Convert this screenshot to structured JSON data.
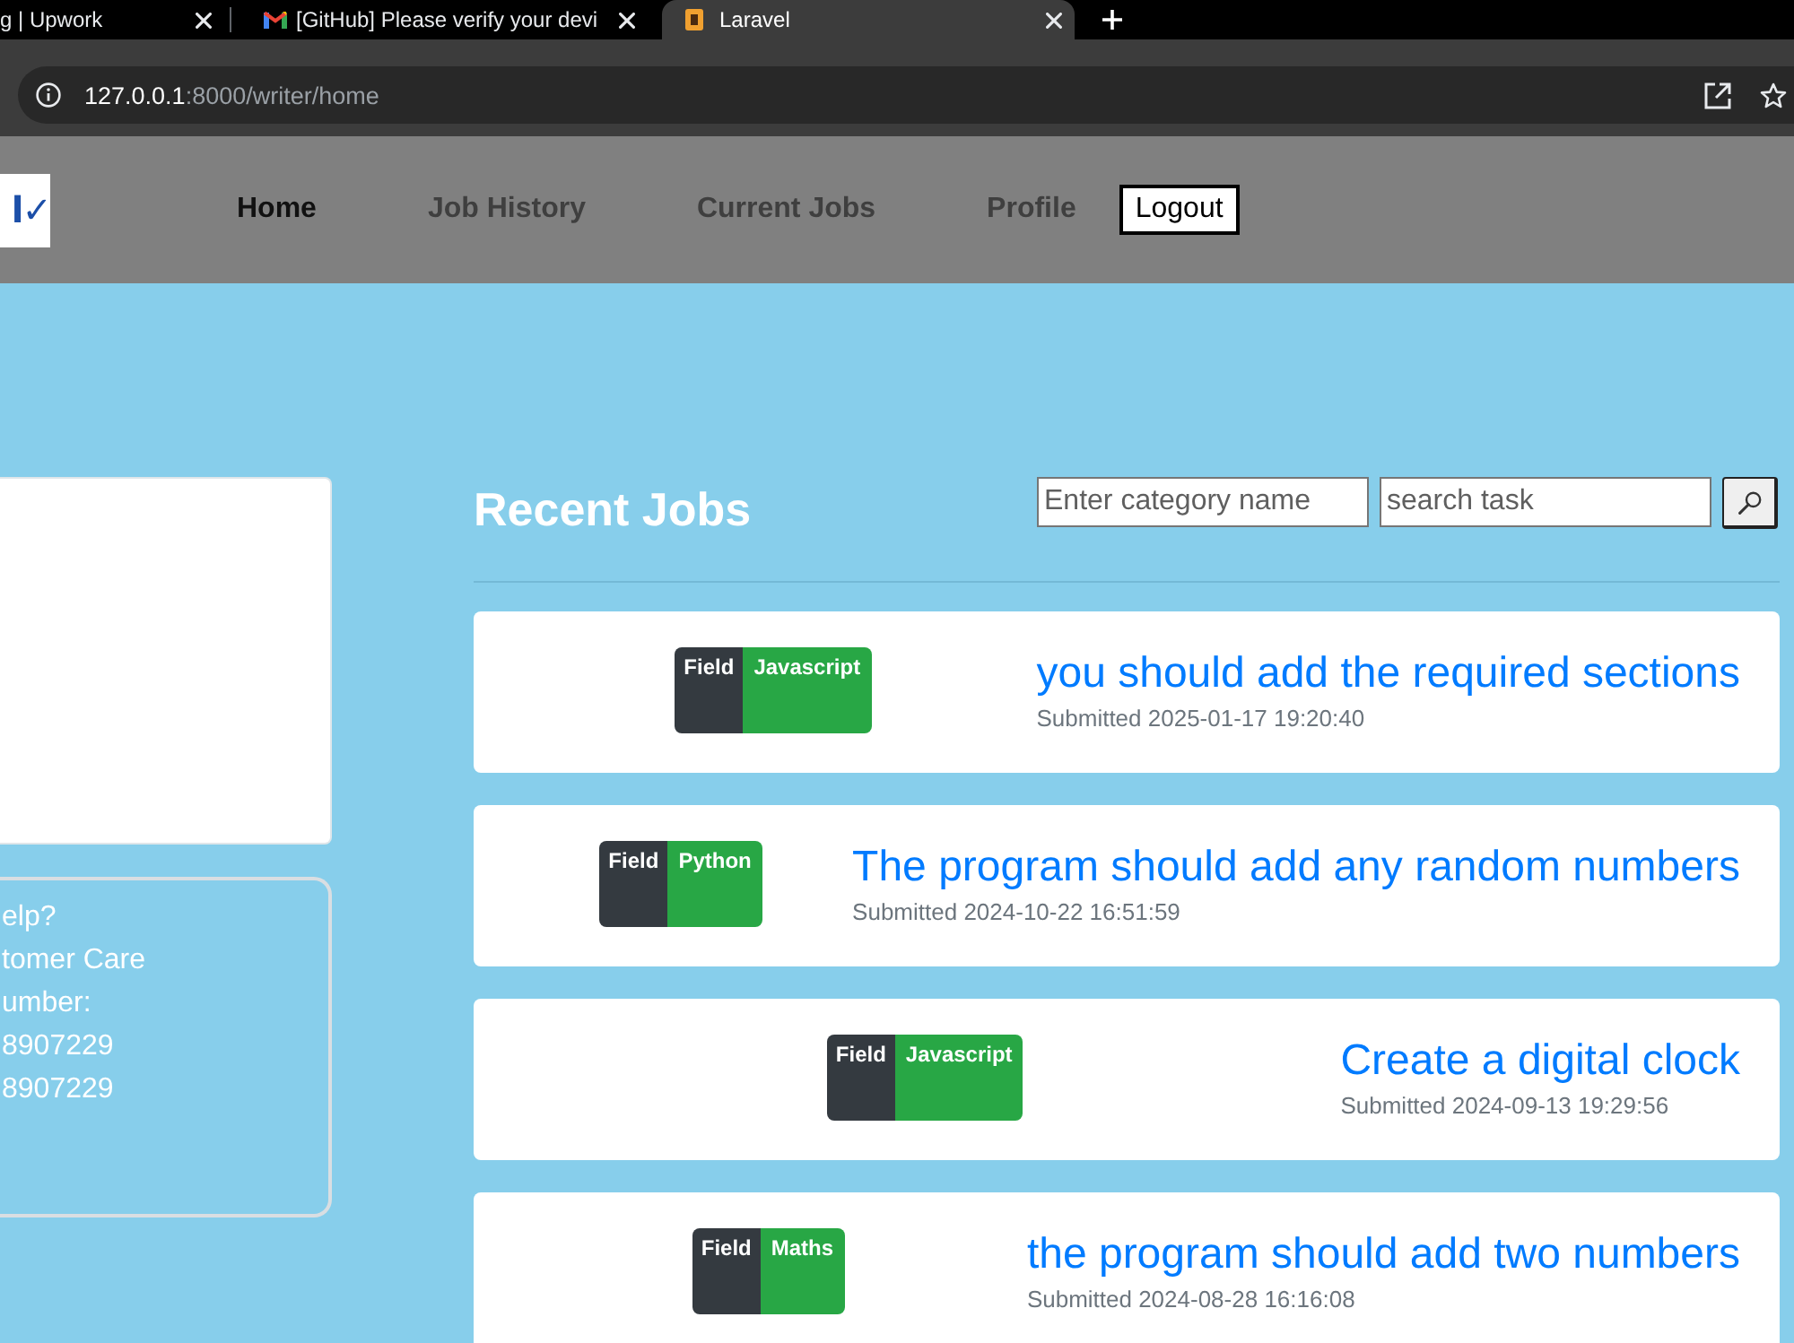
{
  "browser": {
    "tabs": [
      {
        "title": "g | Upwork",
        "selected": false
      },
      {
        "title": "[GitHub] Please verify your devi",
        "selected": false
      },
      {
        "title": "Laravel",
        "selected": true
      }
    ],
    "address": {
      "host": "127.0.0.1",
      "path": ":8000/writer/home"
    }
  },
  "navbar": {
    "logo": "l✓",
    "links": [
      {
        "label": "Home",
        "selected": true
      },
      {
        "label": "Job History",
        "selected": false
      },
      {
        "label": "Current Jobs",
        "selected": false
      },
      {
        "label": "Profile",
        "selected": false
      }
    ],
    "logout": "Logout"
  },
  "sidebar": {
    "help_lines": [
      "elp?",
      "tomer Care",
      "umber:",
      "8907229",
      "8907229"
    ]
  },
  "recent_jobs": {
    "heading": "Recent Jobs",
    "category_search": {
      "placeholder": "Enter category name"
    },
    "task_search": {
      "placeholder": "search task"
    },
    "jobs": [
      {
        "field_label": "Field",
        "category": "Javascript",
        "title": "you should add the required sections",
        "submitted": "Submitted 2025-01-17 19:20:40"
      },
      {
        "field_label": "Field",
        "category": "Python",
        "title": "The program should add any random numbers",
        "submitted": "Submitted 2024-10-22 16:51:59"
      },
      {
        "field_label": "Field",
        "category": "Javascript",
        "title": "Create a digital clock",
        "submitted": "Submitted 2024-09-13 19:29:56"
      },
      {
        "field_label": "Field",
        "category": "Maths",
        "title": "the program should add two numbers",
        "submitted": "Submitted 2024-08-28 16:16:08"
      }
    ]
  }
}
